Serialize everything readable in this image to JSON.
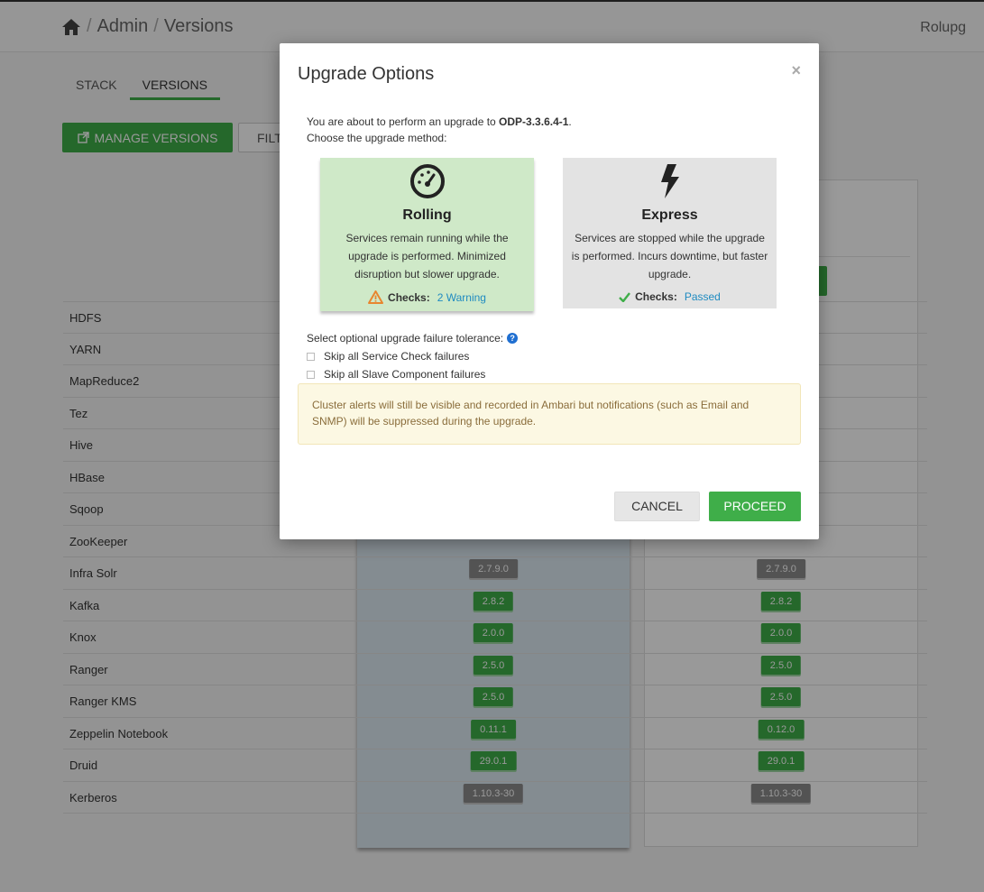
{
  "header": {
    "breadcrumb": [
      "Admin",
      "Versions"
    ],
    "separator": "/",
    "cluster_name": "Rolupg"
  },
  "tabs": [
    {
      "label": "STACK",
      "active": false
    },
    {
      "label": "VERSIONS",
      "active": true
    }
  ],
  "toolbar": {
    "manage_label": "MANAGE VERSIONS",
    "filter_label": "FILT"
  },
  "services": [
    {
      "name": "HDFS",
      "current": "",
      "target": ""
    },
    {
      "name": "YARN",
      "current": "",
      "target": ""
    },
    {
      "name": "MapReduce2",
      "current": "",
      "target": ""
    },
    {
      "name": "Tez",
      "current": "",
      "target": ""
    },
    {
      "name": "Hive",
      "current": "",
      "target": ""
    },
    {
      "name": "HBase",
      "current": "",
      "target": ""
    },
    {
      "name": "Sqoop",
      "current": "",
      "target": ""
    },
    {
      "name": "ZooKeeper",
      "current": "",
      "target": ""
    },
    {
      "name": "Infra Solr",
      "current": "2.7.9.0",
      "target": "2.7.9.0"
    },
    {
      "name": "Kafka",
      "current": "2.8.2",
      "target": "2.8.2"
    },
    {
      "name": "Knox",
      "current": "2.0.0",
      "target": "2.0.0"
    },
    {
      "name": "Ranger",
      "current": "2.5.0",
      "target": "2.5.0"
    },
    {
      "name": "Ranger KMS",
      "current": "2.5.0",
      "target": "2.5.0"
    },
    {
      "name": "Zeppelin Notebook",
      "current": "0.11.1",
      "target": "0.12.0"
    },
    {
      "name": "Druid",
      "current": "29.0.1",
      "target": "29.0.1"
    },
    {
      "name": "Kerberos",
      "current": "1.10.3-30",
      "target": "1.10.3-30"
    }
  ],
  "modal": {
    "title": "Upgrade Options",
    "close": "×",
    "intro_prefix": "You are about to perform an upgrade to ",
    "intro_version": "ODP-3.3.6.4-1",
    "intro_suffix": ".",
    "intro_line2": "Choose the upgrade method:",
    "rolling": {
      "title": "Rolling",
      "desc": "Services remain running while the upgrade is performed. Minimized disruption but slower upgrade.",
      "checks_label": "Checks:",
      "checks_value": "2 Warning"
    },
    "express": {
      "title": "Express",
      "desc": "Services are stopped while the upgrade is performed. Incurs downtime, but faster upgrade.",
      "checks_label": "Checks:",
      "checks_value": "Passed"
    },
    "tolerance_label": "Select optional upgrade failure tolerance:",
    "skip_service_check": "Skip all Service Check failures",
    "skip_slave": "Skip all Slave Component failures",
    "alert": "Cluster alerts will still be visible and recorded in Ambari but notifications (such as Email and SNMP) will be suppressed during the upgrade.",
    "cancel_label": "CANCEL",
    "proceed_label": "PROCEED"
  },
  "colors": {
    "accent_green": "#3fae49",
    "rolling_bg": "#cfe9c8",
    "express_bg": "#e3e3e3",
    "link_blue": "#1f8bc1",
    "warning_orange": "#e8862f"
  }
}
